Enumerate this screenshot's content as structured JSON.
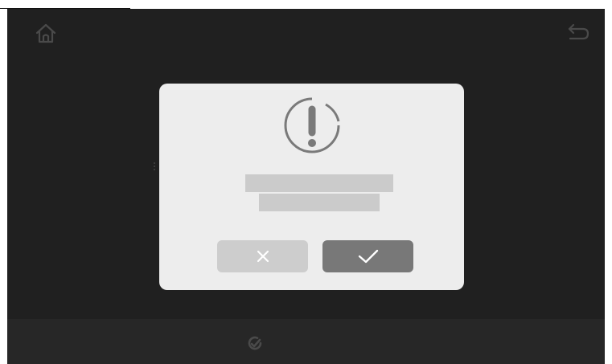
{
  "screen": {
    "colors": {
      "background": "#202020",
      "bottom_bar": "#272727",
      "icon": "#4a4a4a"
    },
    "top_bar": {
      "left_icon": "home-icon",
      "right_icon": "back-arrow-icon"
    },
    "bottom_bar": {
      "center_icon": "refresh-check-icon"
    }
  },
  "dialog": {
    "icon": "alert-circle-icon",
    "message_lines_redacted": 2,
    "colors": {
      "background": "#ededed",
      "icon": "#7a7a7a",
      "message_placeholder": "#cbcbcb",
      "cancel_button": "#cdcdcd",
      "confirm_button": "#787878",
      "button_glyph": "#ffffff"
    },
    "buttons": {
      "cancel_icon": "close-icon",
      "confirm_icon": "checkmark-icon"
    }
  }
}
